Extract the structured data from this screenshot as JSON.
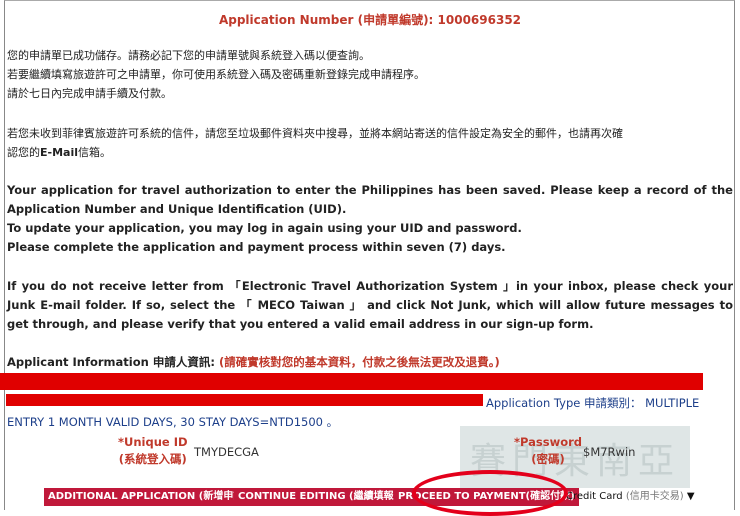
{
  "application_number": "Application Number (申請單編號): 1000696352",
  "zh_saved": [
    "您的申請單已成功儲存。請務必記下您的申請單號與系統登入碼以便查詢。",
    "若要繼續填寫旅遊許可之申請單，你可使用系統登入碼及密碼重新登錄完成申請程序。",
    "請於七日內完成申請手續及付款。"
  ],
  "zh_junk_1": "若您未收到菲律賓旅遊許可系統的信件，請您至垃圾郵件資料夾中搜尋，並將本網站寄送的信件設定為安全的郵件，也請再次確",
  "zh_junk_2_prefix": "認您的",
  "zh_junk_2_bold": "E-Mail",
  "zh_junk_2_suffix": "信箱。",
  "en_saved": "Your application for travel authorization to enter the Philippines has been saved. Please keep a record of the Application Number and Unique Identification (UID).",
  "en_update": "To update your application, you may log in again using your UID and password.",
  "en_complete": "Please complete the application and payment process within seven (7) days.",
  "en_junk": "If you do not receive letter from 「Electronic Travel Authorization System 」in your inbox, please check your Junk E-mail folder. If so, select the 「 MECO Taiwan 」 and click Not Junk, which will allow future messages to get through, and please verify that you entered a valid email address in our sign-up form.",
  "applicant_info_label": "Applicant Information 申請人資訊: ",
  "applicant_info_note": "(請確實核對您的基本資料，付款之後無法更改及退費。)",
  "application_type": "Application Type 申請類別： MULTIPLE",
  "application_type_cont": "ENTRY 1 MONTH VALID DAYS, 30 STAY DAYS=NTD1500 。",
  "uid_label": "*Unique ID",
  "uid_label_zh": "(系統登入碼)",
  "uid_value": "TMYDECGA",
  "watermark": "賽門東南亞",
  "password_label": "*Password",
  "password_label_zh": "(密碼)",
  "password_value": "$M7Rwin",
  "buttons": {
    "additional": "ADDITIONAL APPLICATION (新增申請)",
    "continue": "CONTINUE EDITING (繼續填報)",
    "proceed": "PROCEED TO PAYMENT(確認付款)"
  },
  "payment_select": {
    "selected": "Credit Card",
    "selected_zh": "(信用卡交易)"
  },
  "colors": {
    "accent_red": "#c0392b",
    "button_bg": "#c0183a",
    "link_blue": "#1d3f8a",
    "redaction": "#e00000"
  }
}
